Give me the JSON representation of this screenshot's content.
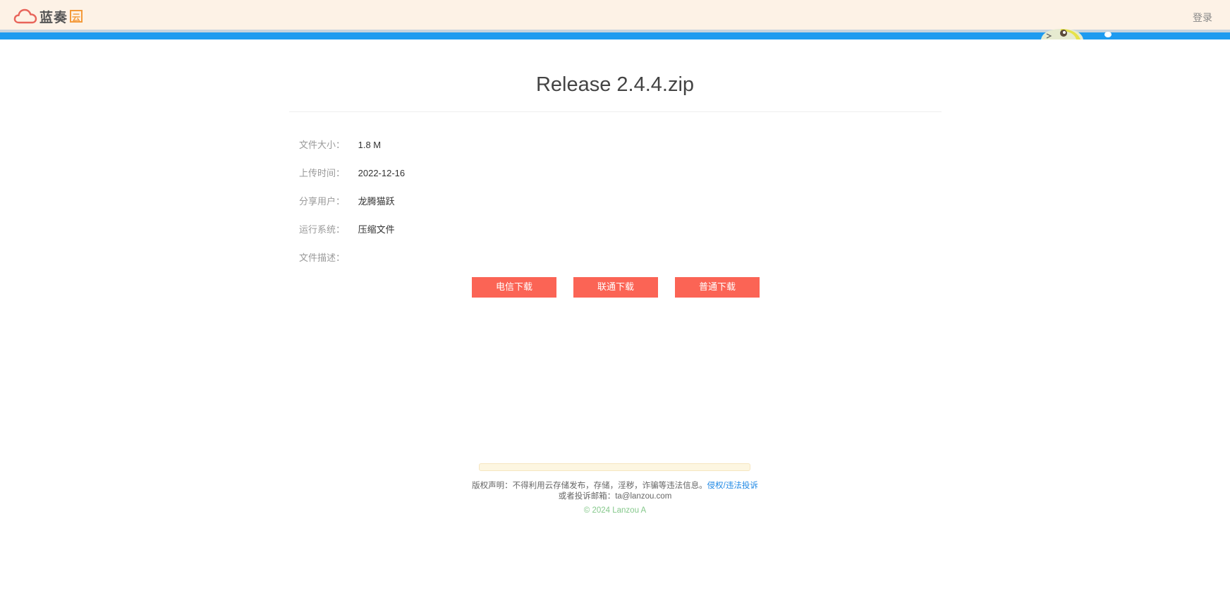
{
  "header": {
    "logo_text": "蓝奏",
    "logo_badge": "云",
    "login_label": "登录"
  },
  "file": {
    "title": "Release 2.4.4.zip",
    "info": [
      {
        "label": "文件大小：",
        "value": "1.8 M"
      },
      {
        "label": "上传时间：",
        "value": "2022-12-16"
      },
      {
        "label": "分享用户：",
        "value": "龙腾猫跃"
      },
      {
        "label": "运行系统：",
        "value": "压缩文件"
      },
      {
        "label": "文件描述：",
        "value": ""
      }
    ]
  },
  "downloads": {
    "telecom": "电信下载",
    "unicom": "联通下载",
    "normal": "普通下载"
  },
  "footer": {
    "notice": "版权声明：不得利用云存储发布，存储，淫秽，诈骗等违法信息。",
    "report_link": "侵权/违法投诉",
    "email_line": "或者投诉邮箱：ta@lanzou.com",
    "copyright": "© 2024 Lanzou A"
  },
  "colors": {
    "header_bg": "#fdf2e6",
    "header_stripe": "#1e9bf0",
    "button": "#fb6455",
    "link": "#1e88e5",
    "copyright": "#85c88b"
  }
}
